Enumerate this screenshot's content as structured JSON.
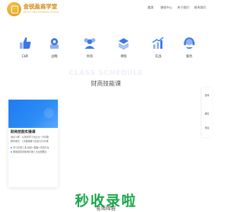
{
  "header": {
    "brand_name": "金锐盈商学堂",
    "brand_sub": "JIN RUI YING BUSINESS SCHOOL",
    "nav": [
      {
        "label": "首页"
      },
      {
        "label": "课程中心"
      },
      {
        "label": "关于我们"
      },
      {
        "label": "联系我们"
      }
    ]
  },
  "categories": [
    {
      "label": "口碑",
      "icon": "thumbs-up-icon"
    },
    {
      "label": "战略",
      "icon": "gear-stack-icon"
    },
    {
      "label": "师资",
      "icon": "teachers-icon"
    },
    {
      "label": "课程",
      "icon": "course-icon"
    },
    {
      "label": "实战",
      "icon": "growth-chart-icon"
    },
    {
      "label": "服务",
      "icon": "service-icon"
    }
  ],
  "section": {
    "watermark": "CLASS SCHEDULE",
    "title": "财商技能课"
  },
  "course_card": {
    "title": "财商技能实操课",
    "lines": [
      "适合人群：认知到学习为企业一切可能",
      "教学模式：1天直播课+在线1对1补课",
      "学习记录工具/运营+直播+内容平台",
      "基础回答到营销方面三大运营要点"
    ]
  },
  "side_nav": [
    {
      "label": "咨询"
    },
    {
      "label": "微信"
    },
    {
      "label": "电话"
    }
  ],
  "overlay": {
    "big_text": "秒收录啦",
    "sub_text": "名师阵容"
  },
  "colors": {
    "brand": "#d28a12",
    "accent_blue": "#2d8cf5",
    "overlay_green": "#1aa84a"
  }
}
